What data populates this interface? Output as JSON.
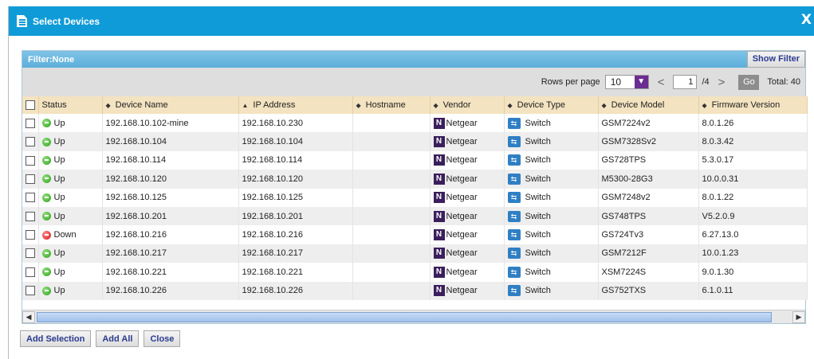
{
  "dialog": {
    "title": "Select Devices",
    "close_glyph": "X"
  },
  "filter": {
    "label": "Filter:None",
    "show_filter_label": "Show Filter"
  },
  "pager": {
    "rows_per_page_label": "Rows per page",
    "rows_per_page_value": "10",
    "page_value": "1",
    "page_total": "/4",
    "prev_glyph": "<",
    "next_glyph": ">",
    "go_label": "Go",
    "total_label": "Total: 40"
  },
  "columns": [
    "Status",
    "Device Name",
    "IP Address",
    "Hostname",
    "Vendor",
    "Device Type",
    "Device Model",
    "Firmware Version"
  ],
  "rows": [
    {
      "status": "Up",
      "name": "192.168.10.102-mine",
      "ip": "192.168.10.230",
      "hostname": "",
      "vendor": "Netgear",
      "type": "Switch",
      "model": "GSM7224v2",
      "firmware": "8.0.1.26"
    },
    {
      "status": "Up",
      "name": "192.168.10.104",
      "ip": "192.168.10.104",
      "hostname": "",
      "vendor": "Netgear",
      "type": "Switch",
      "model": "GSM7328Sv2",
      "firmware": "8.0.3.42"
    },
    {
      "status": "Up",
      "name": "192.168.10.114",
      "ip": "192.168.10.114",
      "hostname": "",
      "vendor": "Netgear",
      "type": "Switch",
      "model": "GS728TPS",
      "firmware": "5.3.0.17"
    },
    {
      "status": "Up",
      "name": "192.168.10.120",
      "ip": "192.168.10.120",
      "hostname": "",
      "vendor": "Netgear",
      "type": "Switch",
      "model": "M5300-28G3",
      "firmware": "10.0.0.31"
    },
    {
      "status": "Up",
      "name": "192.168.10.125",
      "ip": "192.168.10.125",
      "hostname": "",
      "vendor": "Netgear",
      "type": "Switch",
      "model": "GSM7248v2",
      "firmware": "8.0.1.22"
    },
    {
      "status": "Up",
      "name": "192.168.10.201",
      "ip": "192.168.10.201",
      "hostname": "",
      "vendor": "Netgear",
      "type": "Switch",
      "model": "GS748TPS",
      "firmware": "V5.2.0.9"
    },
    {
      "status": "Down",
      "name": "192.168.10.216",
      "ip": "192.168.10.216",
      "hostname": "",
      "vendor": "Netgear",
      "type": "Switch",
      "model": "GS724Tv3",
      "firmware": "6.27.13.0"
    },
    {
      "status": "Up",
      "name": "192.168.10.217",
      "ip": "192.168.10.217",
      "hostname": "",
      "vendor": "Netgear",
      "type": "Switch",
      "model": "GSM7212F",
      "firmware": "10.0.1.23"
    },
    {
      "status": "Up",
      "name": "192.168.10.221",
      "ip": "192.168.10.221",
      "hostname": "",
      "vendor": "Netgear",
      "type": "Switch",
      "model": "XSM7224S",
      "firmware": "9.0.1.30"
    },
    {
      "status": "Up",
      "name": "192.168.10.226",
      "ip": "192.168.10.226",
      "hostname": "",
      "vendor": "Netgear",
      "type": "Switch",
      "model": "GS752TXS",
      "firmware": "6.1.0.11"
    }
  ],
  "buttons": {
    "add_selection": "Add Selection",
    "add_all": "Add All",
    "close": "Close"
  },
  "icons": {
    "vendor_letter": "N",
    "title_icon": "document-icon",
    "status_up": "status-up-icon",
    "status_down": "status-down-icon",
    "switch": "switch-icon"
  },
  "colors": {
    "titlebar": "#0f9bd8",
    "header_row": "#f3e3c0",
    "up": "#2f9e1c",
    "down": "#d01515",
    "accent": "#6b2c91"
  }
}
